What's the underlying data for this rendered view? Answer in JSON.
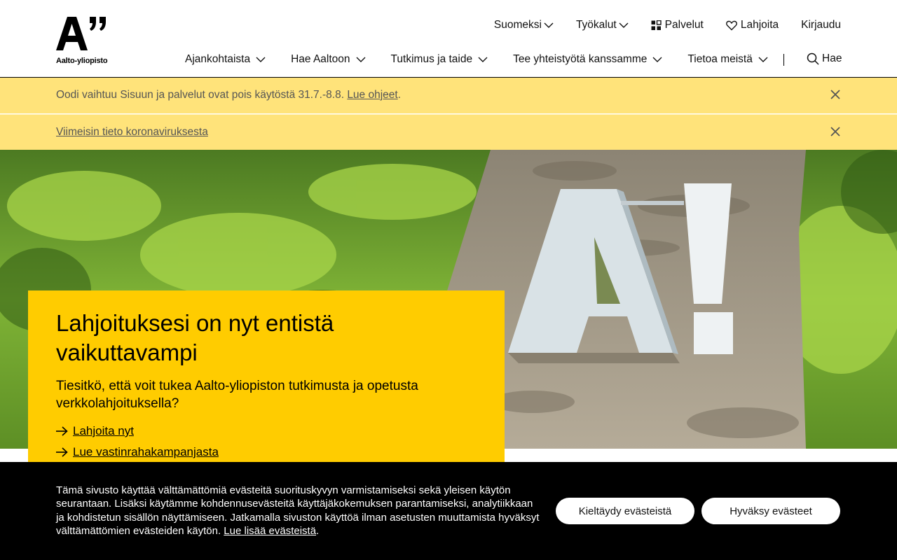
{
  "brand": {
    "logo_mark": "A”",
    "logo_text": "Aalto-yliopisto"
  },
  "util_nav": {
    "language": "Suomeksi",
    "tools": "Työkalut",
    "services": "Palvelut",
    "donate": "Lahjoita",
    "login": "Kirjaudu"
  },
  "main_nav": [
    {
      "label": "Ajankohtaista"
    },
    {
      "label": "Hae Aaltoon"
    },
    {
      "label": "Tutkimus ja taide"
    },
    {
      "label": "Tee yhteistyötä kanssamme"
    },
    {
      "label": "Tietoa meistä"
    }
  ],
  "search": {
    "label": "Hae"
  },
  "notices": [
    {
      "text": "Oodi vaihtuu Sisuun ja palvelut ovat pois käytöstä 31.7.-8.8. ",
      "link": "Lue ohjeet",
      "suffix": "."
    },
    {
      "text": "",
      "link": "Viimeisin tieto koronaviruksesta",
      "suffix": ""
    }
  ],
  "promo": {
    "title": "Lahjoituksesi on nyt entistä vaikuttavampi",
    "body": "Tiesitkö, että voit tukea Aalto-yliopiston tutkimusta ja opetusta verkkolahjoituksella?",
    "link1": "Lahjoita nyt",
    "link2": "Lue vastinrahakampanjasta"
  },
  "cookie": {
    "text": "Tämä sivusto käyttää välttämättömiä evästeitä suorituskyvyn varmistamiseksi sekä yleisen käytön seurantaan. Lisäksi käytämme kohdennusevästeitä käyttäjäkokemuksen parantamiseksi, analytiikkaan ja kohdistetun sisällön näyttämiseen. Jatkamalla sivuston käyttöä ilman asetusten muuttamista hyväksyt välttämättömien evästeiden käytön. ",
    "link": "Lue lisää evästeistä",
    "suffix": ".",
    "decline": "Kieltäydy evästeistä",
    "accept": "Hyväksy evästeet"
  },
  "colors": {
    "notice_bg": "#ffe37a",
    "promo_bg": "#ffcc00",
    "cookie_bg": "#000000"
  }
}
